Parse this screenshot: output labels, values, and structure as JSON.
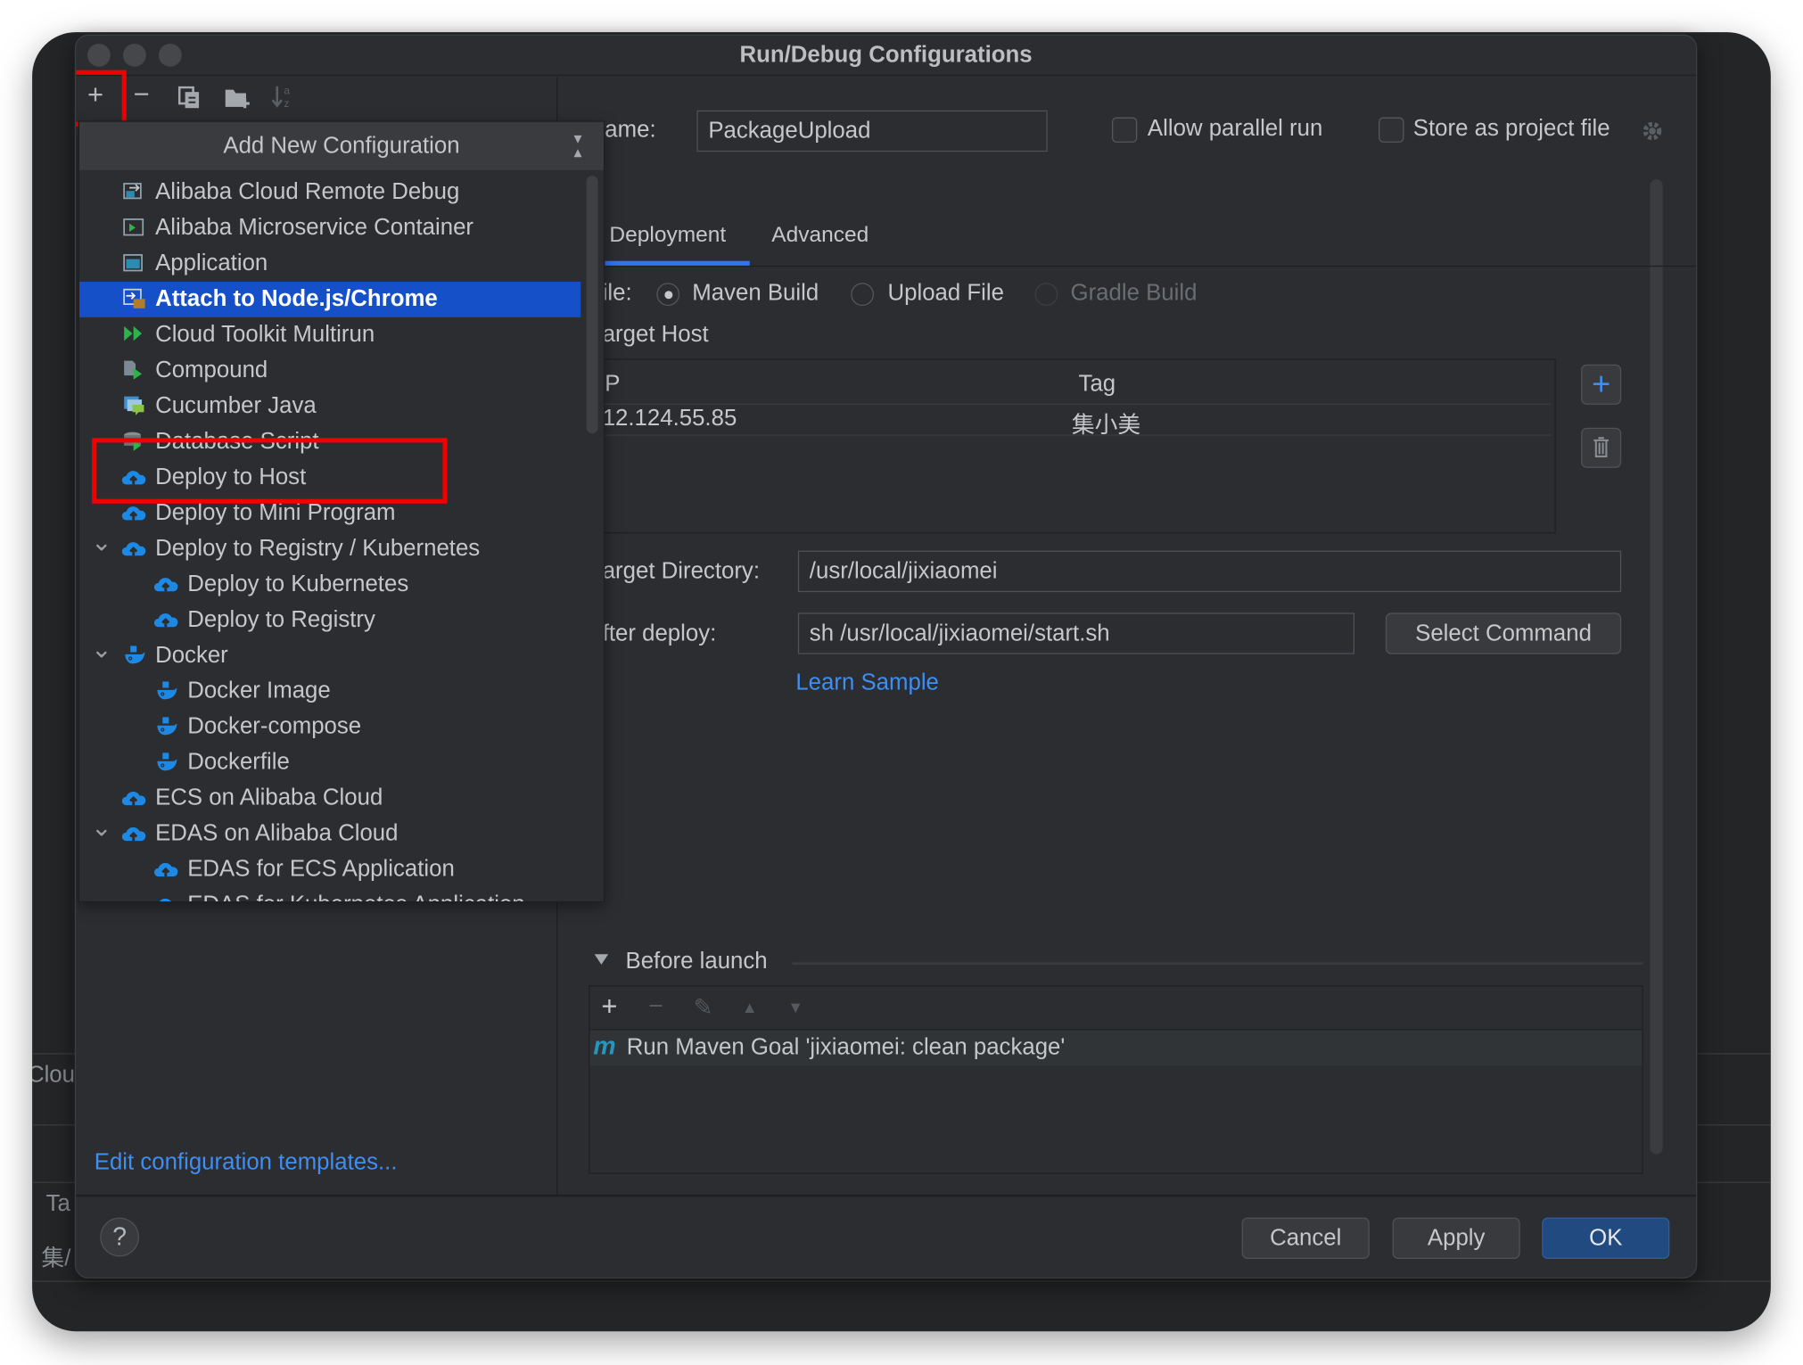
{
  "background_window": {
    "fragments": [
      "Clou",
      "Ta",
      "集/"
    ]
  },
  "dialog": {
    "title": "Run/Debug Configurations",
    "toolbar": {
      "add": "+",
      "remove": "−"
    },
    "popup": {
      "header": "Add New Configuration",
      "items": [
        {
          "label": "Alibaba Cloud Remote Debug",
          "icon": "remote-debug-icon",
          "level": 0
        },
        {
          "label": "Alibaba Microservice Container",
          "icon": "container-icon",
          "level": 0
        },
        {
          "label": "Application",
          "icon": "application-icon",
          "level": 0
        },
        {
          "label": "Attach to Node.js/Chrome",
          "icon": "nodejs-attach-icon",
          "level": 0,
          "selected": true
        },
        {
          "label": "Cloud Toolkit Multirun",
          "icon": "multirun-icon",
          "level": 0
        },
        {
          "label": "Compound",
          "icon": "compound-icon",
          "level": 0
        },
        {
          "label": "Cucumber Java",
          "icon": "cucumber-icon",
          "level": 0
        },
        {
          "label": "Database Script",
          "icon": "database-icon",
          "level": 0
        },
        {
          "label": "Deploy to Host",
          "icon": "cloud-upload-icon",
          "level": 0,
          "highlighted": true
        },
        {
          "label": "Deploy to Mini Program",
          "icon": "cloud-upload-icon",
          "level": 0
        },
        {
          "label": "Deploy to Registry / Kubernetes",
          "icon": "cloud-upload-icon",
          "level": 0,
          "expanded": true
        },
        {
          "label": "Deploy to Kubernetes",
          "icon": "cloud-upload-icon",
          "level": 1
        },
        {
          "label": "Deploy to Registry",
          "icon": "cloud-upload-icon",
          "level": 1
        },
        {
          "label": "Docker",
          "icon": "docker-icon",
          "level": 0,
          "expanded": true
        },
        {
          "label": "Docker Image",
          "icon": "docker-icon",
          "level": 1
        },
        {
          "label": "Docker-compose",
          "icon": "docker-icon",
          "level": 1
        },
        {
          "label": "Dockerfile",
          "icon": "docker-icon",
          "level": 1
        },
        {
          "label": "ECS on Alibaba Cloud",
          "icon": "cloud-upload-icon",
          "level": 0
        },
        {
          "label": "EDAS on Alibaba Cloud",
          "icon": "cloud-upload-icon",
          "level": 0,
          "expanded": true
        },
        {
          "label": "EDAS for ECS Application",
          "icon": "cloud-upload-icon",
          "level": 1
        },
        {
          "label": "EDAS for Kubernetes Application",
          "icon": "cloud-upload-icon",
          "level": 1
        }
      ]
    },
    "edit_templates_link": "Edit configuration templates...",
    "form": {
      "name_label": "ame:",
      "name_value": "PackageUpload",
      "allow_parallel_label": "Allow parallel run",
      "allow_parallel_checked": false,
      "store_project_label": "Store as project file",
      "store_project_checked": false,
      "tabs": [
        {
          "label": "Deployment",
          "active": true
        },
        {
          "label": "Advanced",
          "active": false
        }
      ],
      "file_label": "ile:",
      "file_options": [
        {
          "label": "Maven Build",
          "selected": true,
          "disabled": false
        },
        {
          "label": "Upload File",
          "selected": false,
          "disabled": false
        },
        {
          "label": "Gradle Build",
          "selected": false,
          "disabled": true
        }
      ],
      "target_host_label": "arget Host",
      "hosts_table": {
        "columns": [
          "P",
          "Tag"
        ],
        "rows": [
          [
            "12.124.55.85",
            "集小美"
          ]
        ]
      },
      "target_directory_label": "arget Directory:",
      "target_directory_value": "/usr/local/jixiaomei",
      "after_deploy_label": "fter deploy:",
      "after_deploy_value": "sh /usr/local/jixiaomei/start.sh",
      "select_command": "Select Command",
      "learn_sample": "Learn Sample",
      "before_launch_label": "Before launch",
      "before_launch_tasks": [
        "Run Maven Goal 'jixiaomei: clean package'"
      ]
    },
    "footer": {
      "help": "?",
      "cancel": "Cancel",
      "apply": "Apply",
      "ok": "OK"
    }
  },
  "colors": {
    "accent": "#3574f0",
    "selection": "#1550c9",
    "ok_button": "#214a81",
    "link": "#3f8ef2",
    "annotation_red": "#f20000"
  }
}
